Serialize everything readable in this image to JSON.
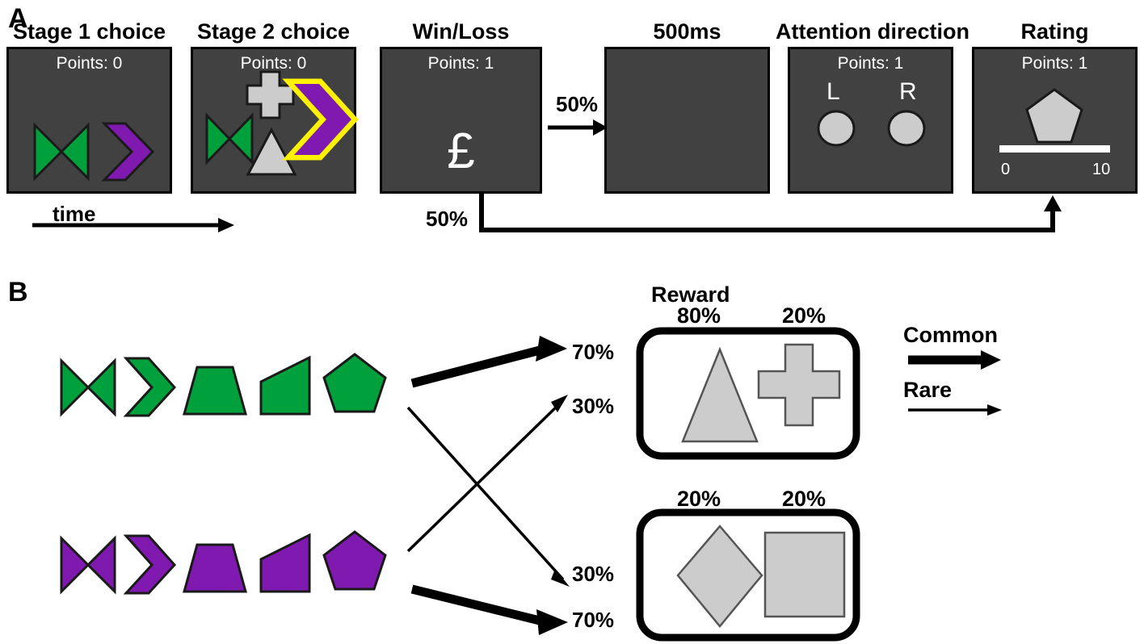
{
  "figure": {
    "panels": [
      {
        "letter": "A"
      },
      {
        "letter": "B"
      }
    ]
  },
  "panel_a": {
    "letter": "A",
    "time_label": "time",
    "branch_top_pct": "50%",
    "branch_bottom_pct": "50%",
    "screens": [
      {
        "title": "Stage 1 choice",
        "points": "Points: 0",
        "shapes": [
          "green-bowtie",
          "purple-chevron"
        ]
      },
      {
        "title": "Stage 2 choice",
        "points": "Points: 0",
        "shapes": [
          "green-bowtie",
          "grey-cross",
          "grey-triangle",
          "purple-chevron-selected-yellow"
        ]
      },
      {
        "title": "Win/Loss",
        "points": "Points: 1",
        "symbol": "£"
      },
      {
        "title": "500ms",
        "points": "",
        "shapes": []
      },
      {
        "title": "Attention direction",
        "points": "Points: 1",
        "left_cue": "L",
        "right_cue": "R",
        "shapes": [
          "grey-circle-left",
          "grey-circle-right"
        ]
      },
      {
        "title": "Rating",
        "points": "Points: 1",
        "shapes": [
          "grey-pentagon"
        ],
        "scale_min": "0",
        "scale_max": "10"
      }
    ]
  },
  "panel_b": {
    "letter": "B",
    "reward_label": "Reward",
    "stage1_rows": [
      {
        "color_name": "green",
        "color": "#00A03C",
        "shapes": [
          "bowtie",
          "chevron",
          "trapezoid",
          "right-trapezoid",
          "pentagon"
        ]
      },
      {
        "color_name": "purple",
        "color": "#8019B0",
        "shapes": [
          "bowtie",
          "chevron",
          "trapezoid",
          "right-trapezoid",
          "pentagon"
        ]
      }
    ],
    "transitions": [
      {
        "from": "green",
        "to": "state-1",
        "pct": "70%",
        "kind": "Common"
      },
      {
        "from": "green",
        "to": "state-2",
        "pct": "30%",
        "kind": "Rare"
      },
      {
        "from": "purple",
        "to": "state-1",
        "pct": "30%",
        "kind": "Rare"
      },
      {
        "from": "purple",
        "to": "state-2",
        "pct": "70%",
        "kind": "Common"
      }
    ],
    "transition_labels": {
      "top_common": "70%",
      "top_rare": "30%",
      "bottom_rare": "30%",
      "bottom_common": "70%"
    },
    "second_stage_boxes": [
      {
        "id": "state-1",
        "options": [
          {
            "shape": "triangle",
            "reward_prob": "80%"
          },
          {
            "shape": "cross",
            "reward_prob": "20%"
          }
        ]
      },
      {
        "id": "state-2",
        "options": [
          {
            "shape": "diamond",
            "reward_prob": "20%"
          },
          {
            "shape": "square",
            "reward_prob": "20%"
          }
        ]
      }
    ],
    "legend": [
      {
        "label": "Common",
        "arrow": "thick"
      },
      {
        "label": "Rare",
        "arrow": "thin"
      }
    ]
  },
  "colors": {
    "green": "#00A03C",
    "purple": "#8019B0",
    "yellow": "#FFF200",
    "screen_bg": "#414141",
    "grey_shape": "#CCCCCC",
    "outline": "#1A1A1A",
    "white": "#FFFFFF",
    "black": "#000000"
  }
}
